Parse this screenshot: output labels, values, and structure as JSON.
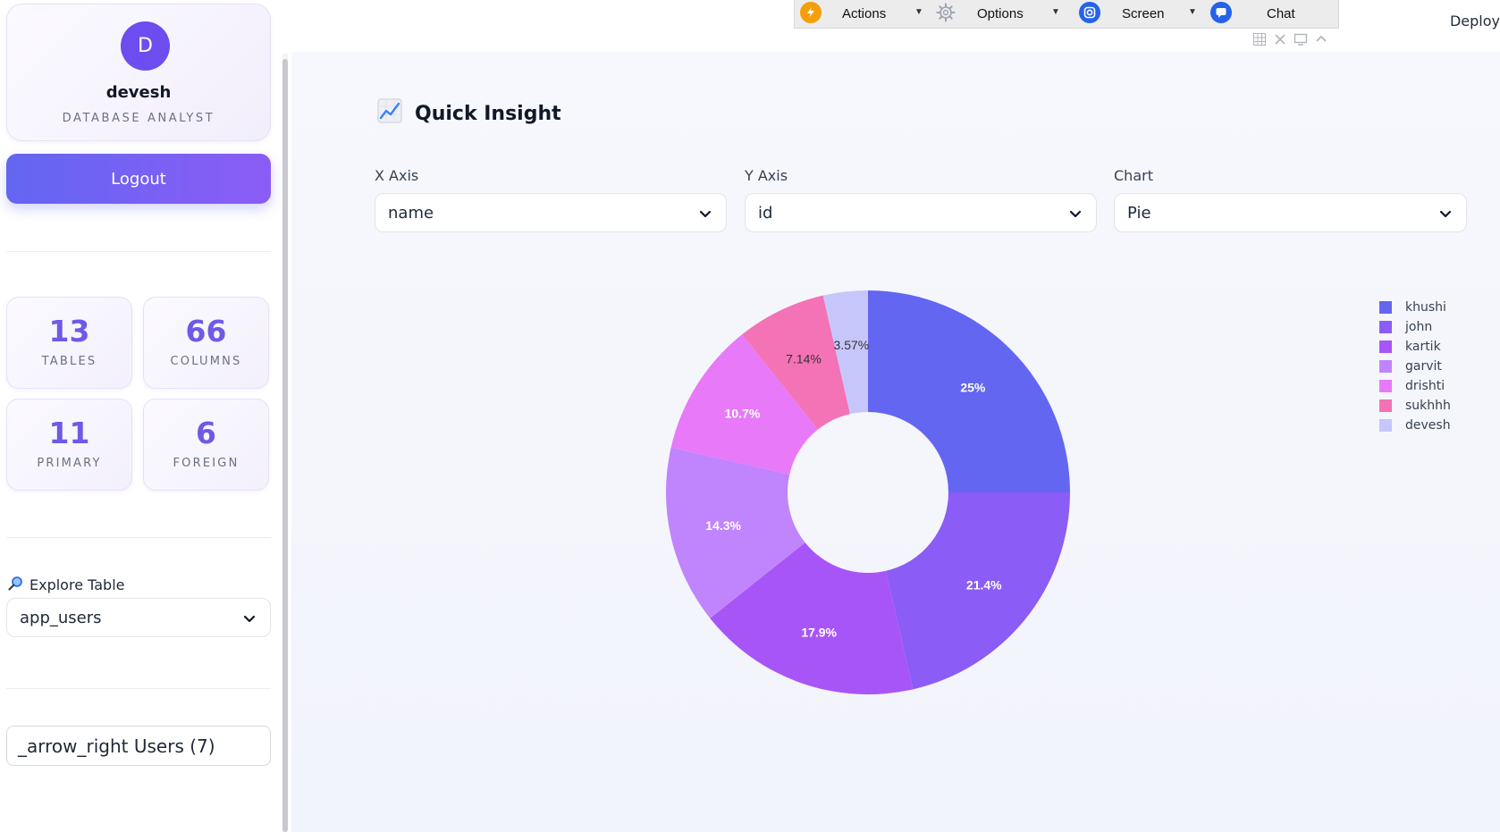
{
  "profile": {
    "avatar_initial": "D",
    "name": "devesh",
    "role": "DATABASE ANALYST"
  },
  "logout": {
    "label": "Logout"
  },
  "stats": [
    {
      "value": "13",
      "label": "TABLES"
    },
    {
      "value": "66",
      "label": "COLUMNS"
    },
    {
      "value": "11",
      "label": "PRIMARY"
    },
    {
      "value": "6",
      "label": "FOREIGN"
    }
  ],
  "explore": {
    "label": "Explore Table",
    "selected": "app_users"
  },
  "bottom_field": {
    "text": "_arrow_right Users (7)"
  },
  "toolbar": {
    "actions": "Actions",
    "options": "Options",
    "screen": "Screen",
    "chat": "Chat"
  },
  "deploy": "Deploy",
  "insight": {
    "title": "Quick Insight",
    "x_axis_label": "X Axis",
    "x_axis_value": "name",
    "y_axis_label": "Y Axis",
    "y_axis_value": "id",
    "chart_label": "Chart",
    "chart_value": "Pie"
  },
  "colors": {
    "accent": "#6366f1",
    "stat_value": "#6d5ae6"
  },
  "chart_data": {
    "type": "pie",
    "hole": true,
    "categories": [
      "khushi",
      "john",
      "kartik",
      "garvit",
      "drishti",
      "sukhhh",
      "devesh"
    ],
    "values": [
      7,
      6,
      5,
      4,
      3,
      2,
      1
    ],
    "data_labels": [
      "25%",
      "21.4%",
      "17.9%",
      "14.3%",
      "10.7%",
      "7.14%",
      "3.57%"
    ],
    "colors": [
      "#6366f1",
      "#8b5cf6",
      "#a855f7",
      "#c084fc",
      "#e879f9",
      "#f472b6",
      "#c7c6fb"
    ],
    "legend_position": "top-right"
  }
}
